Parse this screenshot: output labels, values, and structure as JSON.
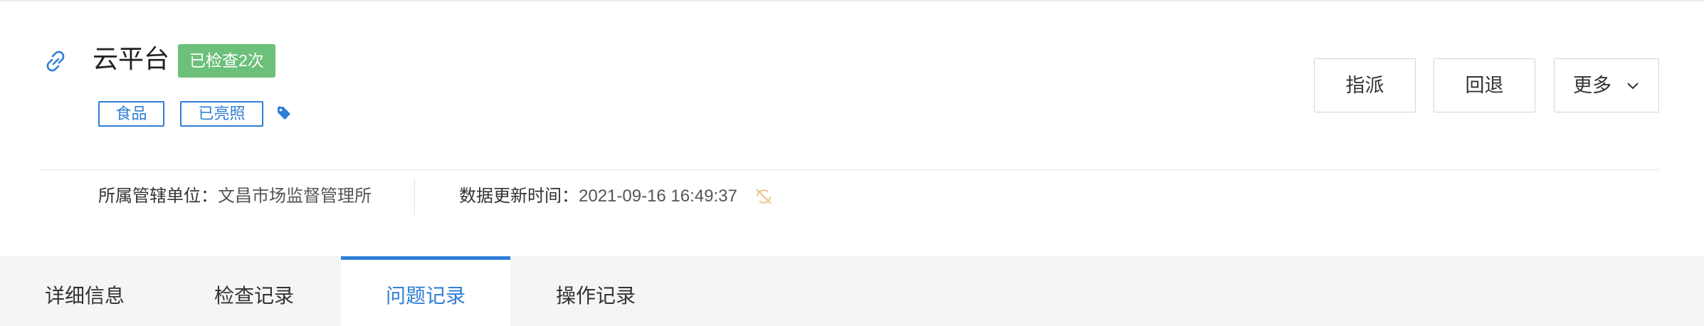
{
  "header": {
    "title": "云平台",
    "check_badge": "已检查2次",
    "tags": [
      "食品",
      "已亮照"
    ],
    "link_icon": "link-icon",
    "tag_icon": "tag-icon"
  },
  "actions": {
    "assign_label": "指派",
    "return_label": "回退",
    "more_label": "更多",
    "more_icon": "chevron-down-icon"
  },
  "meta": {
    "unit_key": "所属管辖单位：",
    "unit_value": "文昌市场监督管理所",
    "time_key": "数据更新时间：",
    "time_value": "2021-09-16 16:49:37",
    "sync_icon": "sync-off-icon"
  },
  "tabs": [
    {
      "label": "详细信息",
      "active": false
    },
    {
      "label": "检查记录",
      "active": false
    },
    {
      "label": "问题记录",
      "active": true
    },
    {
      "label": "操作记录",
      "active": false
    }
  ],
  "colors": {
    "accent": "#2f7ed8",
    "badge_green": "#6cc07a",
    "sync_icon": "#e8c48a"
  }
}
